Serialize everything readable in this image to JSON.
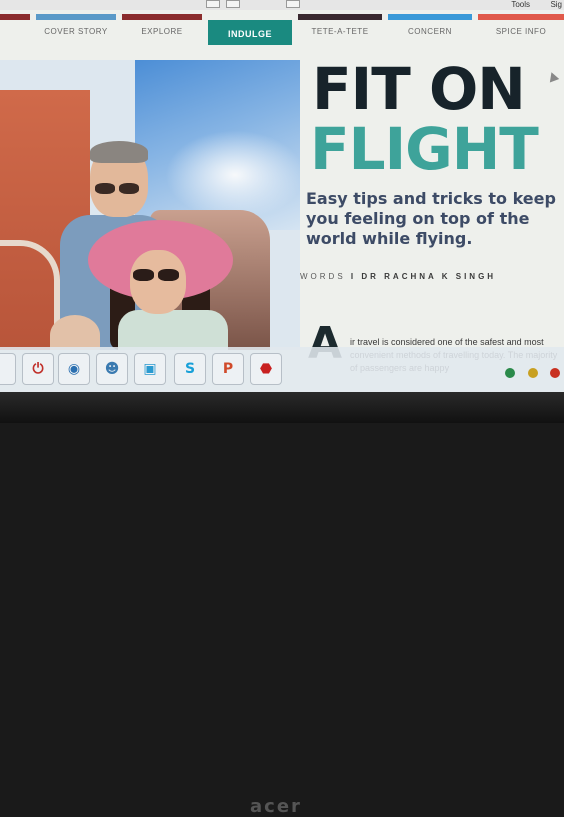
{
  "app_bar": {
    "tools_label": "Tools",
    "sign_label": "Sig"
  },
  "nav": {
    "items": [
      {
        "label": "",
        "color": "#8b2d2d"
      },
      {
        "label": "COVER STORY",
        "color": "#5a9ac8"
      },
      {
        "label": "EXPLORE",
        "color": "#8b2d2d"
      },
      {
        "label": "INDULGE",
        "color": "#1a8a80",
        "active": true
      },
      {
        "label": "TETE-A-TETE",
        "color": "#3a2a30"
      },
      {
        "label": "CONCERN",
        "color": "#3a9ad8"
      },
      {
        "label": "SPICE INFO",
        "color": "#e05a4a"
      }
    ]
  },
  "article": {
    "title_line1": "FIT ON",
    "title_line2": "FLIGHT",
    "subtitle": "Easy tips and tricks to keep you feeling on top of the world while flying.",
    "byline_prefix": "WORDS",
    "byline_sep": "I",
    "byline_author": "DR RACHNA K SINGH",
    "dropcap": "A",
    "body": "ir travel is considered one of the safest and most convenient methods of travelling today. The majority of passengers are happy"
  },
  "taskbar": {
    "buttons": [
      {
        "name": "power-button",
        "icon": "power-icon",
        "glyph": "⏻",
        "color": "#c0302a"
      },
      {
        "name": "app-button-1",
        "icon": "globe-icon",
        "glyph": "◉",
        "color": "#2a6fb0"
      },
      {
        "name": "app-button-2",
        "icon": "people-icon",
        "glyph": "☻",
        "color": "#3a7ab0"
      },
      {
        "name": "app-button-3",
        "icon": "window-icon",
        "glyph": "▣",
        "color": "#2a9ad0"
      },
      {
        "name": "skype-button",
        "icon": "skype-icon",
        "glyph": "S",
        "color": "#18a0d8"
      },
      {
        "name": "powerpoint-button",
        "icon": "powerpoint-icon",
        "glyph": "P",
        "color": "#d04a2a"
      },
      {
        "name": "pdf-reader-button",
        "icon": "pdf-icon",
        "glyph": "⬣",
        "color": "#c82020"
      }
    ]
  },
  "bezel": {
    "brand": "acer"
  }
}
